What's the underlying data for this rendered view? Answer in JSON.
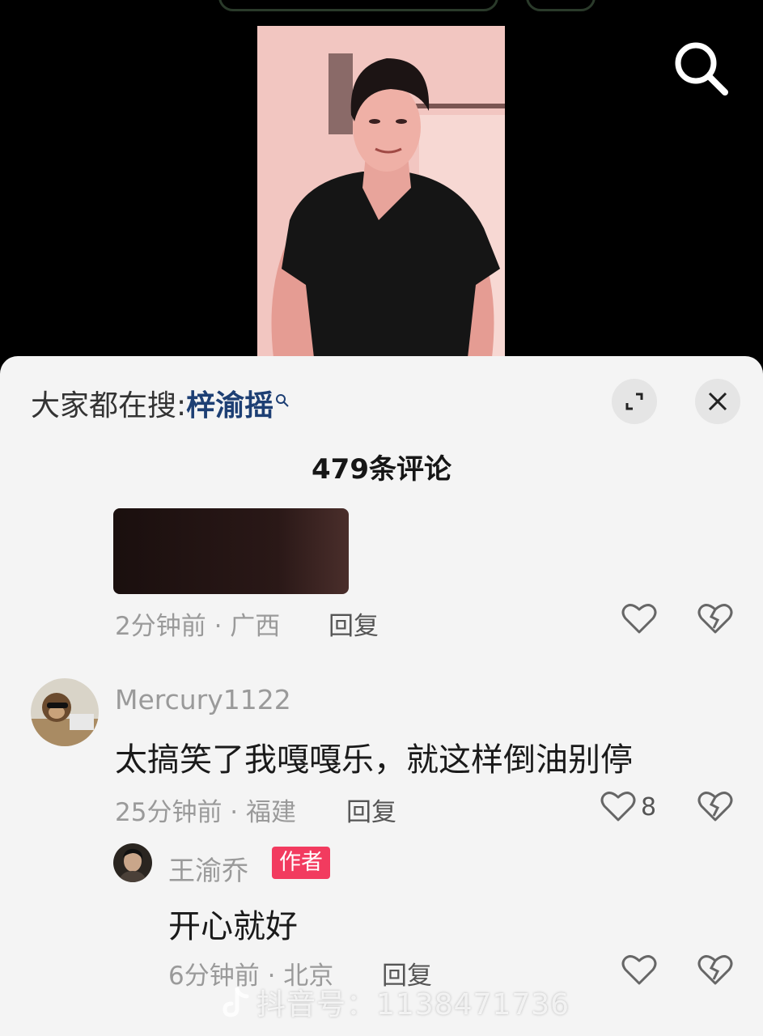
{
  "search_bar": {
    "prefix": "大家都在搜:",
    "term": "梓渝摇"
  },
  "comments_header": {
    "count_text": "479条评论"
  },
  "comments": [
    {
      "meta": "2分钟前 · 广西",
      "reply_label": "回复"
    },
    {
      "username": "Mercury1122",
      "text": "太搞笑了我嘎嘎乐，就这样倒油别停",
      "meta": "25分钟前 · 福建",
      "reply_label": "回复",
      "like_count": "8"
    },
    {
      "username": "王渝乔",
      "badge": "作者",
      "text": "开心就好",
      "meta": "6分钟前 · 北京",
      "reply_label": "回复"
    }
  ],
  "watermark": {
    "text": "抖音号：1138471736"
  },
  "icons": [
    "search-icon",
    "expand-icon",
    "close-icon",
    "heart-icon",
    "broken-heart-icon",
    "douyin-logo-icon"
  ],
  "colors": {
    "badge": "#f23b5f",
    "search_term": "#1d3f74",
    "sheet_bg": "#f4f4f4",
    "meta_gray": "#9a9a9a"
  }
}
